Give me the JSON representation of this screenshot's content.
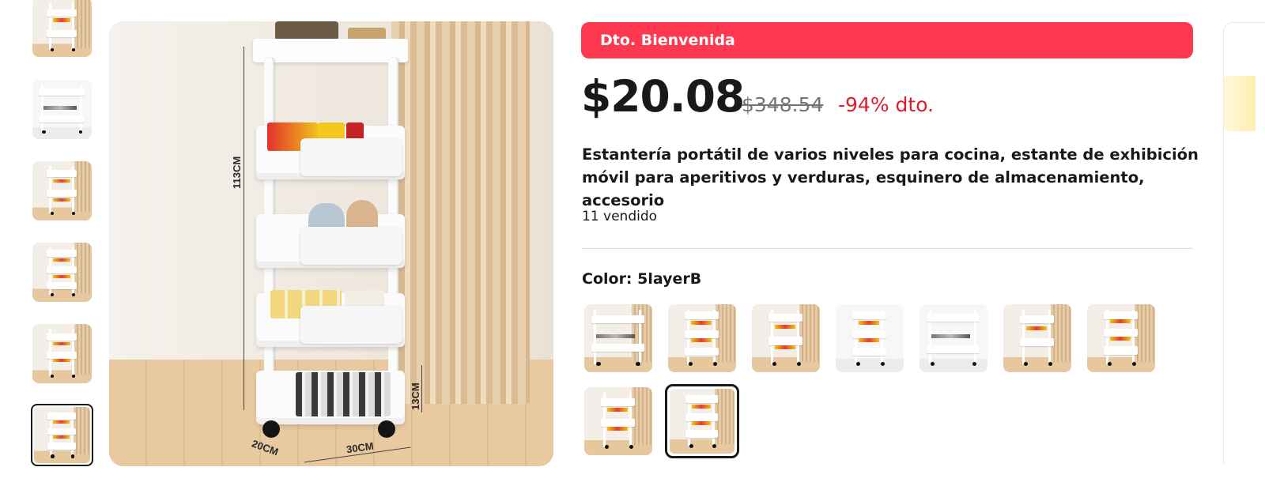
{
  "promo": {
    "label": "Dto. Bienvenida",
    "color": "#fd384f"
  },
  "pricing": {
    "current": "$20.08",
    "original": "$348.54",
    "discount": "-94% dto."
  },
  "product": {
    "title": "Estantería portátil de varios niveles para cocina, estante de exhibición móvil para aperitivos y verduras, esquinero de almacenamiento, accesorio",
    "sold": "11 vendido"
  },
  "photo": {
    "height_label": "113CM",
    "basket_label": "13CM",
    "depth_label": "20CM",
    "width_label": "30CM"
  },
  "variants": {
    "label": "Color: 5layerB",
    "options": [
      "v1",
      "v2",
      "v3",
      "v4",
      "v5",
      "v6",
      "v7",
      "v8",
      "v9"
    ],
    "selected_index": 8
  },
  "gallery": {
    "count": 6,
    "selected_index": 5
  },
  "colors": {
    "price": "#191919",
    "strike": "#757575",
    "discount": "#e01c2b",
    "selected_border": "#191919"
  }
}
